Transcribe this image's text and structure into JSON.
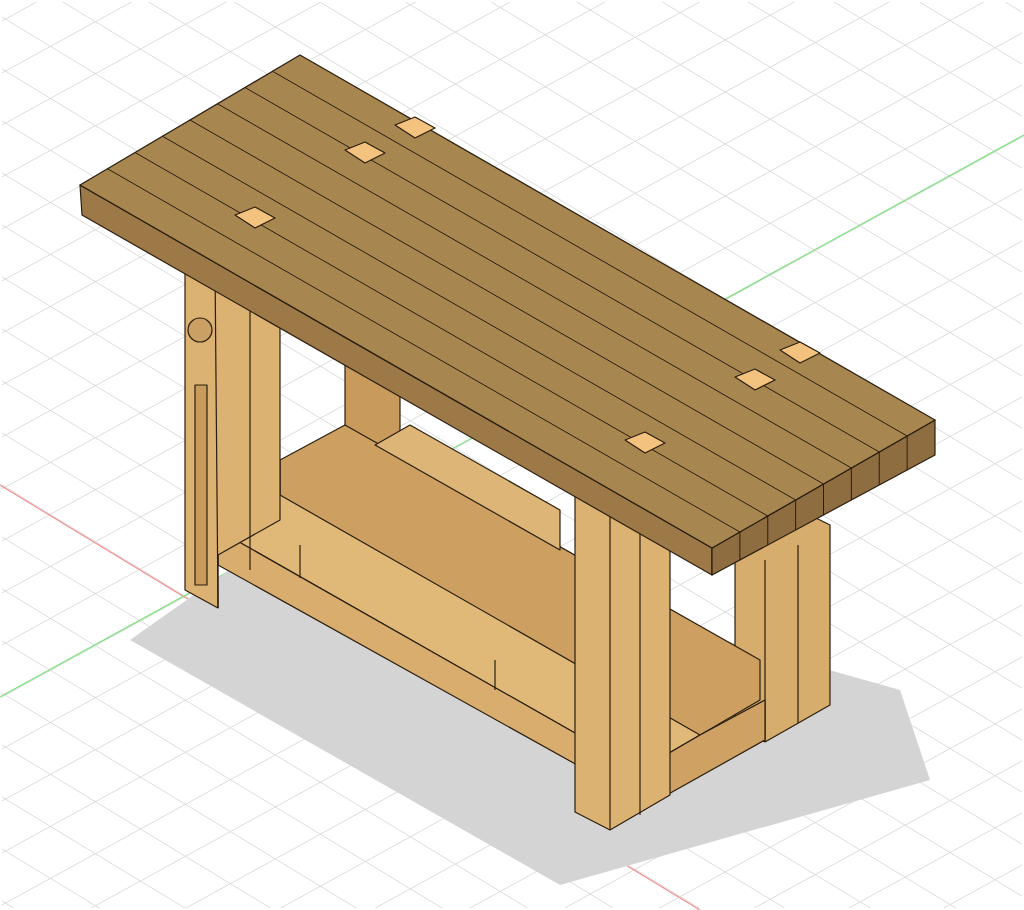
{
  "viewport": {
    "axes": [
      {
        "color": "#f09090"
      },
      {
        "color": "#80e080"
      }
    ]
  }
}
